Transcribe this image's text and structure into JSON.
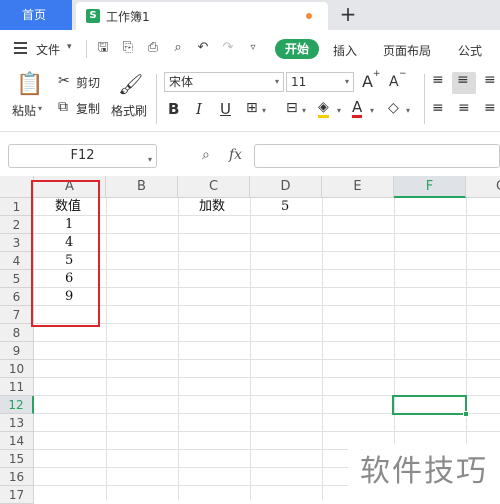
{
  "titlebar": {
    "home_tab": "首页",
    "doc_tab_icon": "S",
    "doc_tab": "工作簿1",
    "new_tab": "+"
  },
  "menu": {
    "file_label": "文件",
    "start_label": "开始",
    "items": [
      "插入",
      "页面布局",
      "公式"
    ]
  },
  "ribbon": {
    "paste": "粘贴",
    "cut": "剪切",
    "copy": "复制",
    "format_painter": "格式刷",
    "font_name": "宋体",
    "font_size": "11",
    "bold": "B",
    "italic": "I",
    "underline": "U",
    "grow_font": "A",
    "shrink_font": "A",
    "font_color": "A"
  },
  "formula_bar": {
    "name_box": "F12",
    "fx": "fx",
    "value": ""
  },
  "grid": {
    "columns": [
      "A",
      "B",
      "C",
      "D",
      "E",
      "F"
    ],
    "partial_column": "G",
    "rows": [
      "1",
      "2",
      "3",
      "4",
      "5",
      "6",
      "7",
      "8",
      "9",
      "10",
      "11",
      "12",
      "13",
      "14",
      "15",
      "16",
      "17"
    ],
    "active_column": "F",
    "active_row": "12",
    "cells": {
      "A1": "数值",
      "A2": "1",
      "A3": "4",
      "A4": "5",
      "A5": "6",
      "A6": "9",
      "C1": "加数",
      "D1": "5"
    }
  },
  "watermark": "软件技巧",
  "colors": {
    "accent_green": "#27a360",
    "home_tab_blue": "#3b7bef",
    "highlight_red": "#d9262a"
  }
}
